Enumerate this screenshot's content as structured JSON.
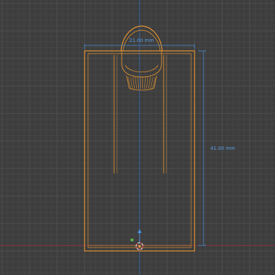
{
  "viewport": {
    "name": "3D Viewport",
    "grid_color": "#4a4a4a",
    "background": "#3d3d3d"
  },
  "colors": {
    "selection_outline": "#e8962e",
    "dimension": "#4a8fdc",
    "axis_x": "#9c3a4a",
    "axis_y_marker": "#5ab04a",
    "axis_z": "#3a6fb8"
  },
  "measurements": {
    "width_label": "21.00 mm",
    "height_label": "41.00 mm"
  },
  "icons": {
    "origin": "3d-cursor-icon",
    "gizmo_z": "z-axis-arrow-icon"
  }
}
